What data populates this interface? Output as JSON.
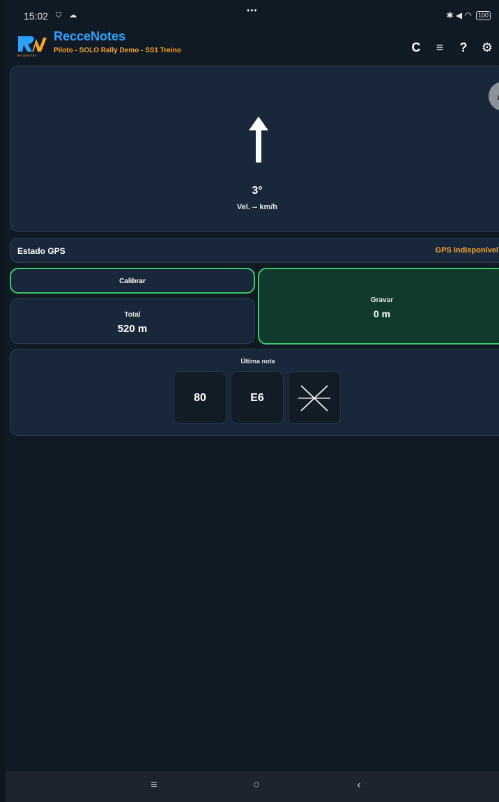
{
  "status_bar": {
    "time": "15:02",
    "left_icons": "⛉ ☁",
    "center": "•••",
    "right_icons": "✱ ◀ ◠",
    "battery": "100"
  },
  "app": {
    "title": "RecceNotes",
    "subtitle": "Piloto - SOLO Rally Demo - SS1 Treino",
    "logo_text": "RN",
    "logo_caption": "RECCENOTES",
    "title_color": "#2aa2ff",
    "subtitle_color": "#f5a623"
  },
  "actions": {
    "refresh": "C",
    "list": "≡",
    "help": "?",
    "settings": "⚙"
  },
  "compass": {
    "heading": "3°",
    "speed": "Vel. -- km/h",
    "side_button": "A"
  },
  "gps": {
    "label": "Estado GPS",
    "status": "GPS indisponível",
    "status_color": "#f5a623"
  },
  "calibrate": {
    "label": "Calibrar"
  },
  "total": {
    "label": "Total",
    "value": "520 m"
  },
  "record": {
    "label": "Gravar",
    "value": "0 m"
  },
  "last_note": {
    "label": "Última nota",
    "tiles": [
      "80",
      "E6"
    ],
    "cross_icon": "cross-icon"
  },
  "nav": {
    "menu": "≡",
    "home": "○",
    "back": "‹"
  }
}
